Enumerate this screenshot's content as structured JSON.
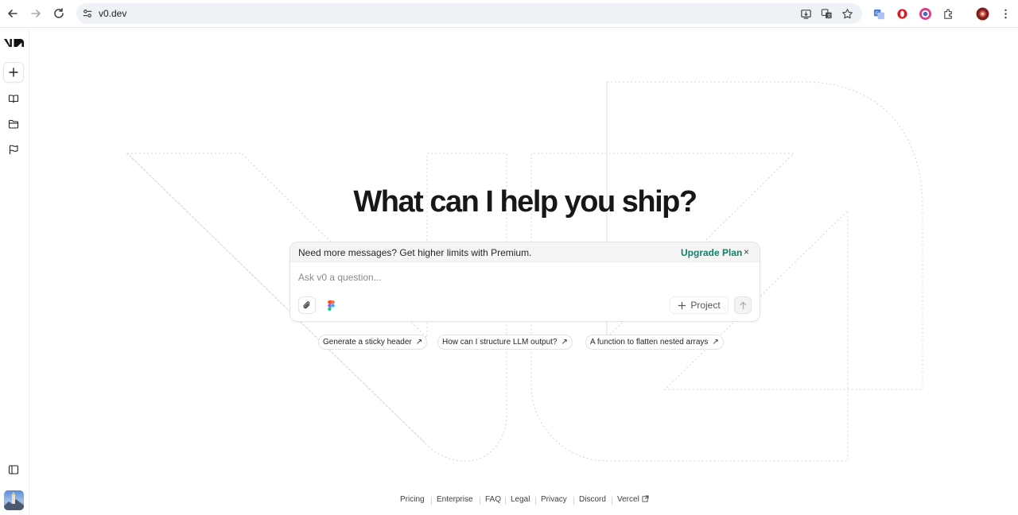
{
  "browser": {
    "url": "v0.dev"
  },
  "main": {
    "headline": "What can I help you ship?",
    "banner": {
      "text": "Need more messages? Get higher limits with Premium.",
      "upgrade_label": "Upgrade Plan",
      "close_label": "×"
    },
    "prompt": {
      "placeholder": "Ask v0 a question...",
      "value": ""
    },
    "project_label": "Project",
    "suggestions": [
      "Generate a sticky header",
      "How can I structure LLM output?",
      "A function to flatten nested arrays"
    ],
    "suggestion_arrow": "↗"
  },
  "footer": {
    "links": [
      "Pricing",
      "Enterprise",
      "FAQ",
      "Legal",
      "Privacy",
      "Discord",
      "Vercel"
    ]
  },
  "colors": {
    "accent_link": "#11806a",
    "text": "#171717"
  }
}
